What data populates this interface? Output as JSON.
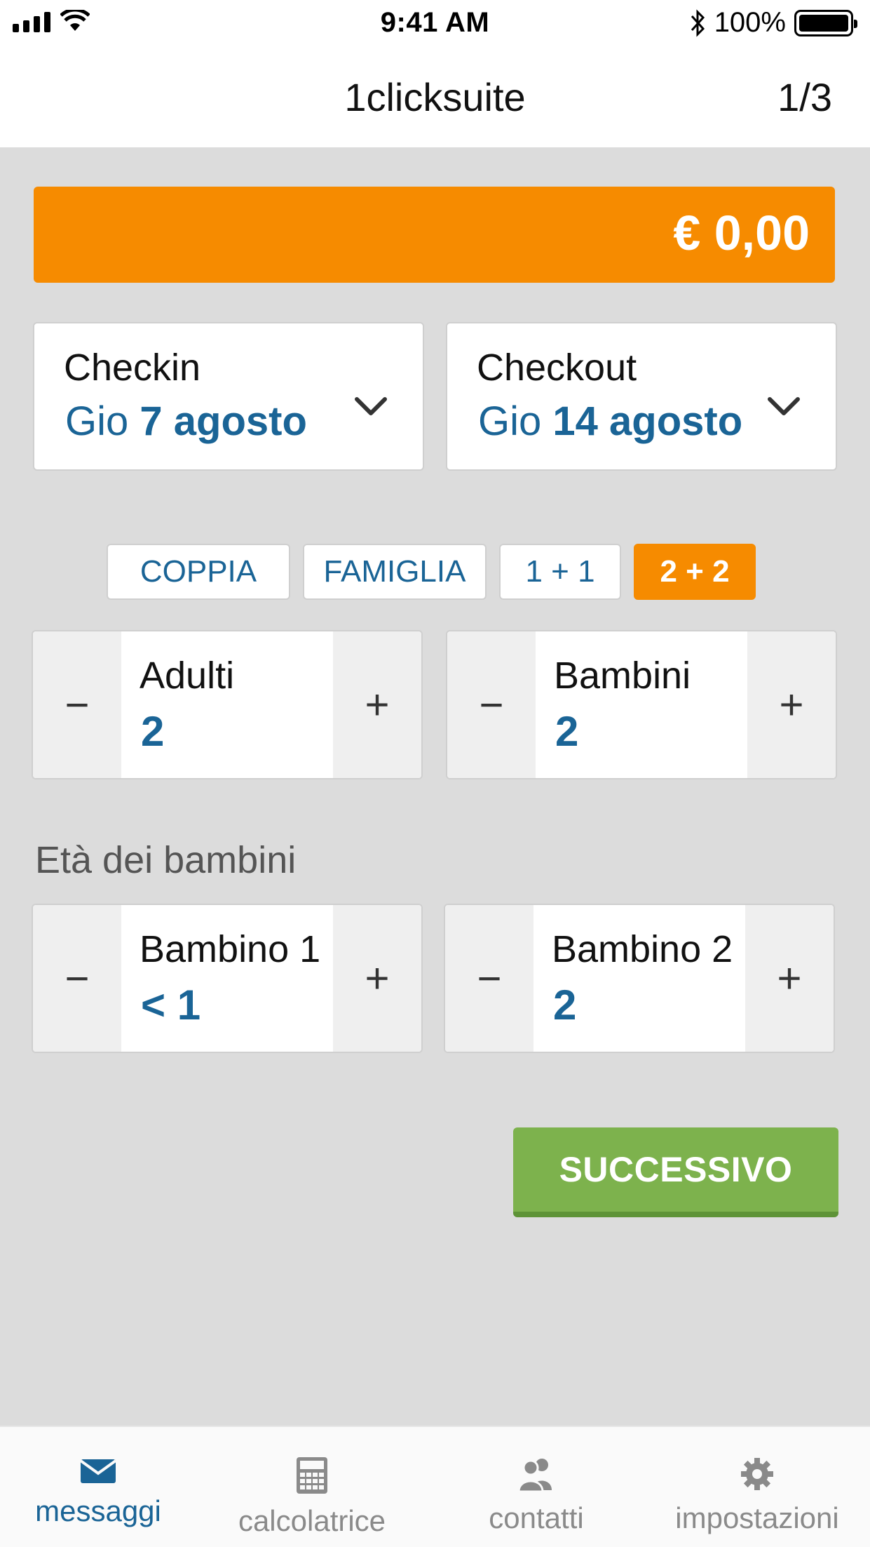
{
  "status_bar": {
    "time": "9:41 AM",
    "battery": "100%"
  },
  "nav": {
    "title": "1clicksuite",
    "page": "1/3"
  },
  "total": {
    "amount": "€ 0,00"
  },
  "checkin": {
    "label": "Checkin",
    "day": "Gio",
    "date": "7 agosto"
  },
  "checkout": {
    "label": "Checkout",
    "day": "Gio",
    "date": "14 agosto"
  },
  "presets": [
    {
      "label": "COPPIA"
    },
    {
      "label": "FAMIGLIA"
    },
    {
      "label": "1 + 1"
    },
    {
      "label": "2 + 2"
    }
  ],
  "adults": {
    "label": "Adulti",
    "value": "2"
  },
  "children": {
    "label": "Bambini",
    "value": "2"
  },
  "children_ages": {
    "title": "Età dei bambini",
    "items": [
      {
        "label": "Bambino 1",
        "value": "< 1"
      },
      {
        "label": "Bambino 2",
        "value": "2"
      }
    ]
  },
  "stepper": {
    "minus": "−",
    "plus": "+"
  },
  "next_button": "SUCCESSIVO",
  "tabs": [
    {
      "label": "messaggi",
      "icon": "envelope-icon"
    },
    {
      "label": "calcolatrice",
      "icon": "calculator-icon"
    },
    {
      "label": "contatti",
      "icon": "contacts-icon"
    },
    {
      "label": "impostazioni",
      "icon": "gear-icon"
    }
  ],
  "colors": {
    "accent": "#f68b00",
    "link": "#1a6496",
    "success": "#7db24d",
    "background": "#dcdcdc"
  }
}
